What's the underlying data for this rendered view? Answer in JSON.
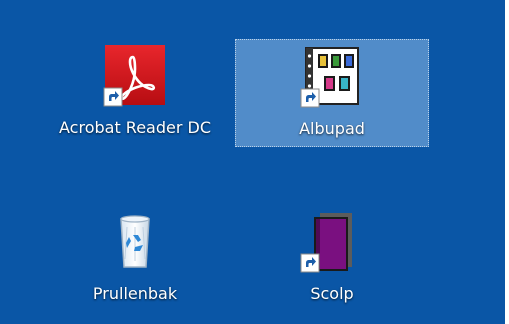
{
  "desktop": {
    "background_color": "#0a56a6",
    "selection_color": "#8cb9e6",
    "icons": [
      {
        "label": "Acrobat Reader DC",
        "icon": "acrobat-reader-icon",
        "shortcut": true,
        "selected": false
      },
      {
        "label": "Albupad",
        "icon": "albupad-icon",
        "shortcut": true,
        "selected": true
      },
      {
        "label": "Prullenbak",
        "icon": "recycle-bin-icon",
        "shortcut": false,
        "selected": false
      },
      {
        "label": "Scolp",
        "icon": "scolp-book-icon",
        "shortcut": true,
        "selected": false
      }
    ]
  }
}
